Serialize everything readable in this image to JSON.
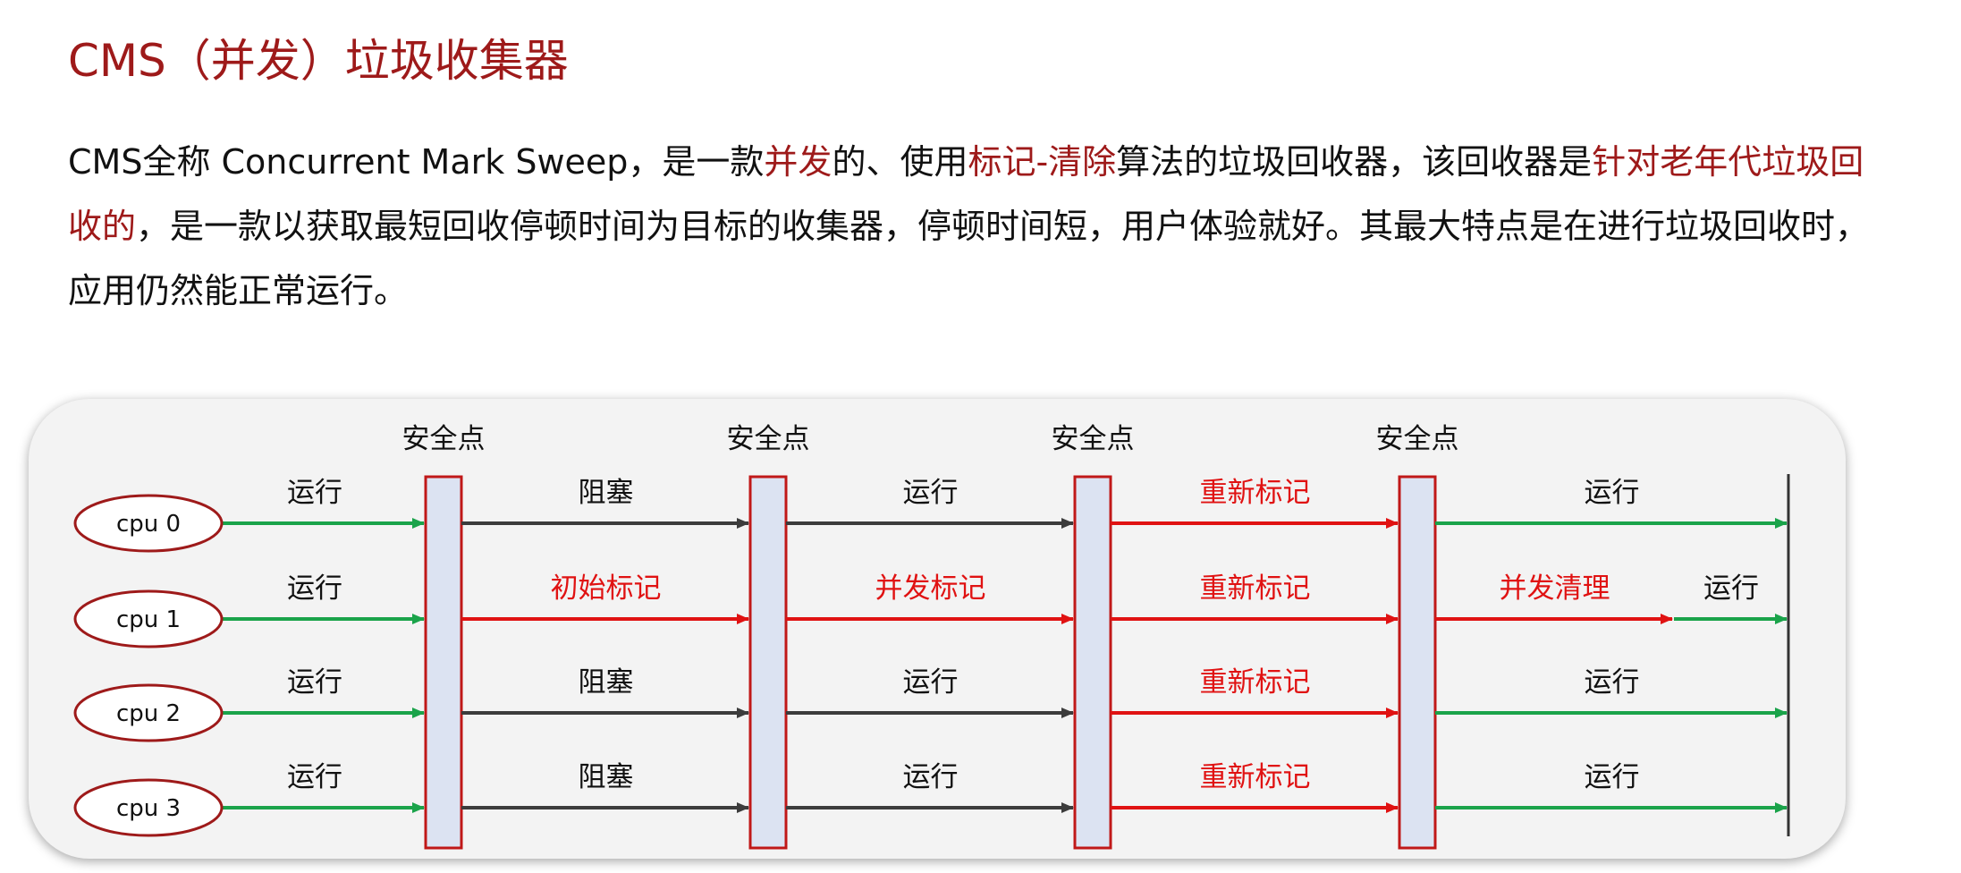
{
  "title": "CMS（并发）垃圾收集器",
  "description": {
    "segments": [
      {
        "text": "CMS全称 Concurrent Mark Sweep，是一款",
        "highlight": false
      },
      {
        "text": "并发",
        "highlight": true
      },
      {
        "text": "的、使用",
        "highlight": false
      },
      {
        "text": "标记-清除",
        "highlight": true
      },
      {
        "text": "算法的垃圾回收器，该回收器是",
        "highlight": false
      },
      {
        "text": "针对老年代垃圾回收的",
        "highlight": true
      },
      {
        "text": "，是一款以获取最短回收停顿时间为目标的收集器，停顿时间短，用户体验就好。其最大特点是在进行垃圾回收时，应用仍然能正常运行。",
        "highlight": false
      }
    ]
  },
  "diagram": {
    "colors": {
      "run": "#1aa34a",
      "block": "#3c3c3c",
      "gc": "#e01212",
      "cpu_border": "#9e1a1a",
      "safepoint_fill": "#dce3f2",
      "safepoint_border": "#c01818"
    },
    "safepoint_label": "安全点",
    "safepoints": [
      "安全点",
      "安全点",
      "安全点",
      "安全点"
    ],
    "cpus": [
      {
        "label": "cpu 0",
        "segments": [
          {
            "label": "运行",
            "kind": "run"
          },
          {
            "label": "阻塞",
            "kind": "block"
          },
          {
            "label": "运行",
            "kind": "block"
          },
          {
            "label": "重新标记",
            "kind": "gc"
          },
          {
            "label": "运行",
            "kind": "run"
          }
        ]
      },
      {
        "label": "cpu 1",
        "segments": [
          {
            "label": "运行",
            "kind": "run"
          },
          {
            "label": "初始标记",
            "kind": "gc"
          },
          {
            "label": "并发标记",
            "kind": "gc"
          },
          {
            "label": "重新标记",
            "kind": "gc"
          },
          {
            "label": "并发清理",
            "kind": "gc"
          },
          {
            "label": "运行",
            "kind": "run"
          }
        ]
      },
      {
        "label": "cpu 2",
        "segments": [
          {
            "label": "运行",
            "kind": "run"
          },
          {
            "label": "阻塞",
            "kind": "block"
          },
          {
            "label": "运行",
            "kind": "block"
          },
          {
            "label": "重新标记",
            "kind": "gc"
          },
          {
            "label": "运行",
            "kind": "run"
          }
        ]
      },
      {
        "label": "cpu 3",
        "segments": [
          {
            "label": "运行",
            "kind": "run"
          },
          {
            "label": "阻塞",
            "kind": "block"
          },
          {
            "label": "运行",
            "kind": "block"
          },
          {
            "label": "重新标记",
            "kind": "gc"
          },
          {
            "label": "运行",
            "kind": "run"
          }
        ]
      }
    ]
  }
}
